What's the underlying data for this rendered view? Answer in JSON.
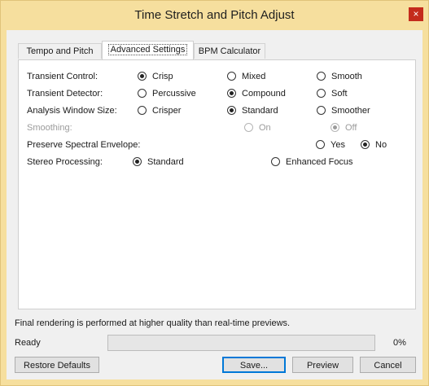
{
  "window": {
    "title": "Time Stretch and Pitch Adjust",
    "close_glyph": "×"
  },
  "tabs": [
    {
      "label": "Tempo and Pitch",
      "active": false
    },
    {
      "label": "Advanced Settings",
      "active": true
    },
    {
      "label": "BPM Calculator",
      "active": false
    }
  ],
  "settings": {
    "transient_control": {
      "label": "Transient Control:",
      "options": [
        "Crisp",
        "Mixed",
        "Smooth"
      ],
      "selected": "Crisp"
    },
    "transient_detector": {
      "label": "Transient Detector:",
      "options": [
        "Percussive",
        "Compound",
        "Soft"
      ],
      "selected": "Compound"
    },
    "analysis_window": {
      "label": "Analysis Window Size:",
      "options": [
        "Crisper",
        "Standard",
        "Smoother"
      ],
      "selected": "Standard"
    },
    "smoothing": {
      "label": "Smoothing:",
      "options": [
        "On",
        "Off"
      ],
      "selected": "Off",
      "disabled": true
    },
    "preserve_envelope": {
      "label": "Preserve Spectral Envelope:",
      "options": [
        "Yes",
        "No"
      ],
      "selected": "No"
    },
    "stereo_processing": {
      "label": "Stereo Processing:",
      "options": [
        "Standard",
        "Enhanced Focus"
      ],
      "selected": "Standard"
    }
  },
  "footer": {
    "info": "Final rendering is performed at higher quality than real-time previews.",
    "status": "Ready",
    "progress_percent": 0,
    "progress_text": "0%"
  },
  "buttons": {
    "restore": "Restore Defaults",
    "save": "Save...",
    "preview": "Preview",
    "cancel": "Cancel"
  },
  "colors": {
    "accent": "#0078d7",
    "title_bar": "#f6df9e",
    "close": "#c42b1c"
  }
}
